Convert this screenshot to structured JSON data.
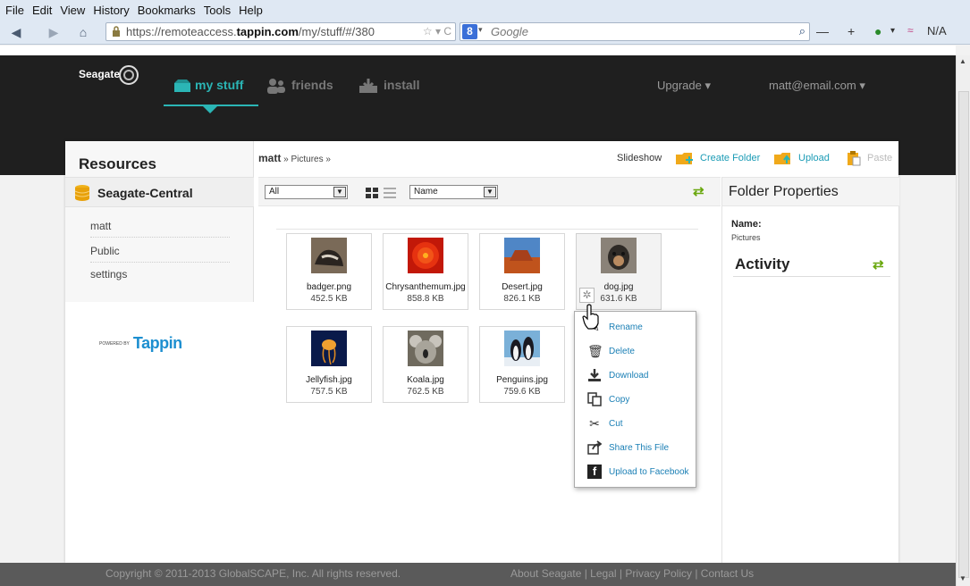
{
  "browser": {
    "menu": [
      "File",
      "Edit",
      "View",
      "History",
      "Bookmarks",
      "Tools",
      "Help"
    ],
    "url_prefix": "https://remoteaccess.",
    "url_host": "tappin.com",
    "url_path": "/my/stuff/#/380",
    "search_engine_glyph": "8",
    "search_placeholder": "Google",
    "toolbar_right_text": "N/A"
  },
  "header": {
    "logo": "Seagate",
    "nav": [
      "my stuff",
      "friends",
      "install"
    ],
    "upgrade": "Upgrade ▾",
    "user": "matt@email.com ▾",
    "accent_color": "#2bb5b5"
  },
  "sidebar": {
    "title": "Resources",
    "device": "Seagate-Central",
    "items": [
      "matt",
      "Public",
      "settings"
    ],
    "powered_by": "POWERED BY",
    "brand": "Tappin"
  },
  "content": {
    "breadcrumb_root": "matt",
    "breadcrumb_rest": " » Pictures »",
    "actions": {
      "slideshow": "Slideshow",
      "create_folder": "Create Folder",
      "upload": "Upload",
      "paste": "Paste"
    },
    "filter_value": "All",
    "sort_value": "Name",
    "files": [
      {
        "name": "badger.png",
        "size": "452.5 KB"
      },
      {
        "name": "Chrysanthemum.jpg",
        "size": "858.8 KB"
      },
      {
        "name": "Desert.jpg",
        "size": "826.1 KB"
      },
      {
        "name": "dog.jpg",
        "size": "631.6 KB"
      },
      {
        "name": "Jellyfish.jpg",
        "size": "757.5 KB"
      },
      {
        "name": "Koala.jpg",
        "size": "762.5 KB"
      },
      {
        "name": "Penguins.jpg",
        "size": "759.6 KB"
      }
    ]
  },
  "properties": {
    "title": "Folder Properties",
    "name_label": "Name:",
    "name_value": "Pictures",
    "activity": "Activity"
  },
  "context_menu": [
    "Rename",
    "Delete",
    "Download",
    "Copy",
    "Cut",
    "Share This File",
    "Upload to Facebook"
  ],
  "footer": {
    "copyright": "Copyright © 2011-2013 GlobalSCAPE, Inc. All rights reserved.",
    "links": "About Seagate | Legal | Privacy Policy | Contact Us"
  }
}
